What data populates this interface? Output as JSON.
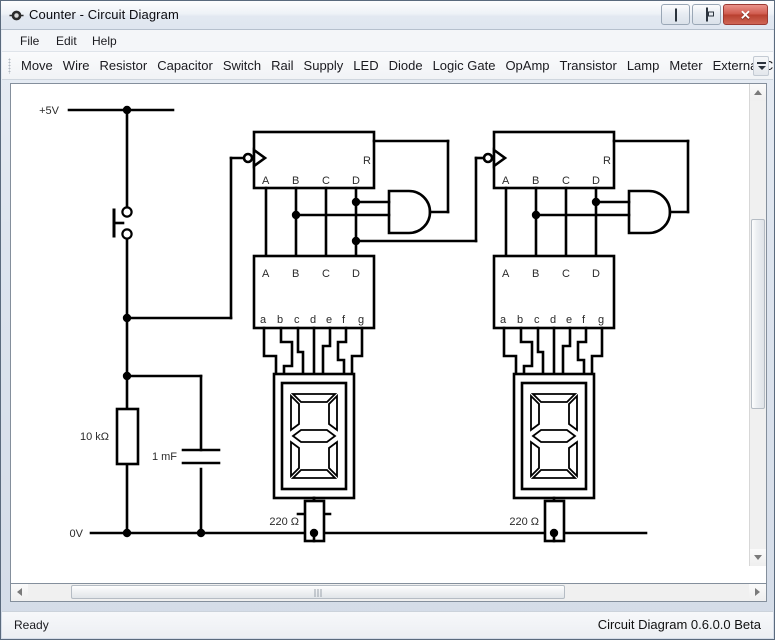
{
  "window": {
    "title": "Counter - Circuit Diagram",
    "icon": "app-icon",
    "buttons": {
      "minimize": "minimize",
      "maximize": "maximize",
      "close": "✕"
    }
  },
  "menu": {
    "items": [
      {
        "label": "File",
        "x": 12
      },
      {
        "label": "Edit",
        "x": 48
      },
      {
        "label": "Help",
        "x": 84
      }
    ]
  },
  "toolbar": {
    "items": [
      "Move",
      "Wire",
      "Resistor",
      "Capacitor",
      "Switch",
      "Rail",
      "Supply",
      "LED",
      "Diode",
      "Logic Gate",
      "OpAmp",
      "Transistor",
      "Lamp",
      "Meter",
      "External Connection"
    ],
    "overflow_icon": "toolbar-overflow-icon"
  },
  "status": {
    "left": "Ready",
    "right": "Circuit Diagram 0.6.0.0 Beta"
  },
  "schematic": {
    "labels": {
      "rail_top": "+5V",
      "rail_bottom": "0V",
      "resistor_pulldown": "10 kΩ",
      "capacitor": "1 mF",
      "resistor_led_1": "220 Ω",
      "resistor_led_2": "220 Ω"
    },
    "counter1": {
      "reset": "R",
      "outputs": [
        "A",
        "B",
        "C",
        "D"
      ]
    },
    "counter2": {
      "reset": "R",
      "outputs": [
        "A",
        "B",
        "C",
        "D"
      ]
    },
    "decoder1": {
      "inputs": [
        "A",
        "B",
        "C",
        "D"
      ],
      "segments": [
        "a",
        "b",
        "c",
        "d",
        "e",
        "f",
        "g"
      ]
    },
    "decoder2": {
      "inputs": [
        "A",
        "B",
        "C",
        "D"
      ],
      "segments": [
        "a",
        "b",
        "c",
        "d",
        "e",
        "f",
        "g"
      ]
    },
    "colors": {
      "wire": "#000000",
      "label": "#2b2b2b",
      "background": "#ffffff"
    }
  }
}
